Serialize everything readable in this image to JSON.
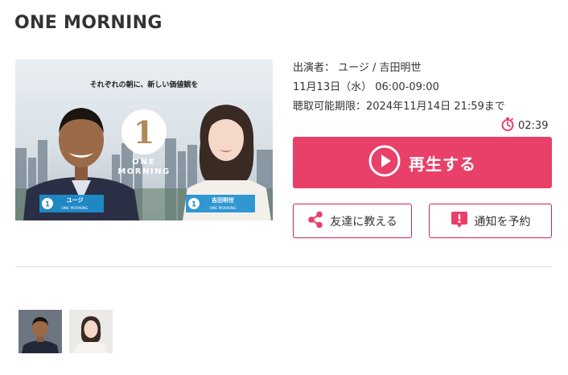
{
  "program": {
    "title": "ONE MORNING",
    "performers": "出演者： ユージ / 吉田明世",
    "airtime": "11月13日（水） 06:00-09:00",
    "deadline": "聴取可能期限：2024年11月14日 21:59まで",
    "remaining": "02:39"
  },
  "thumbnail": {
    "tagline": "それぞれの朝に、新しい価値観を",
    "logo_number": "1",
    "logo_line1": "ONE",
    "logo_line2": "MORNING",
    "host1_name": "ユージ",
    "host2_name": "吉田明世",
    "badge_sub": "ONE MORNING"
  },
  "actions": {
    "play_label": "再生する",
    "share_label": "友達に教える",
    "notify_label": "通知を予約"
  },
  "colors": {
    "accent": "#e84069",
    "border": "#c8245a"
  }
}
